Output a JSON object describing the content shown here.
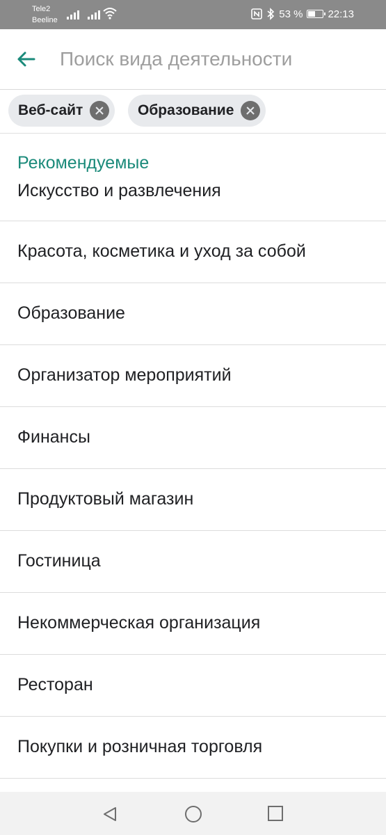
{
  "status_bar": {
    "carrier1": "Tele2",
    "carrier2": "Beeline",
    "battery_text": "53 %",
    "battery_level": 0.53,
    "time": "22:13",
    "icons": [
      "signal-icon",
      "signal-icon",
      "wifi-icon",
      "nfc-icon",
      "bluetooth-icon",
      "battery-icon"
    ]
  },
  "app_bar": {
    "back_icon": "arrow-back-icon",
    "search_placeholder": "Поиск вида деятельности",
    "accent_color": "#1a8a7a"
  },
  "chips": [
    {
      "label": "Веб-сайт"
    },
    {
      "label": "Образование"
    }
  ],
  "list": {
    "section_title": "Рекомендуемые",
    "items": [
      "Искусство и развлечения",
      "Красота, косметика и уход за собой",
      "Образование",
      "Организатор мероприятий",
      "Финансы",
      "Продуктовый магазин",
      "Гостиница",
      "Некоммерческая организация",
      "Ресторан",
      "Покупки и розничная торговля"
    ]
  },
  "nav_bar": {
    "buttons": [
      "back-triangle-icon",
      "home-circle-icon",
      "recents-square-icon"
    ]
  }
}
